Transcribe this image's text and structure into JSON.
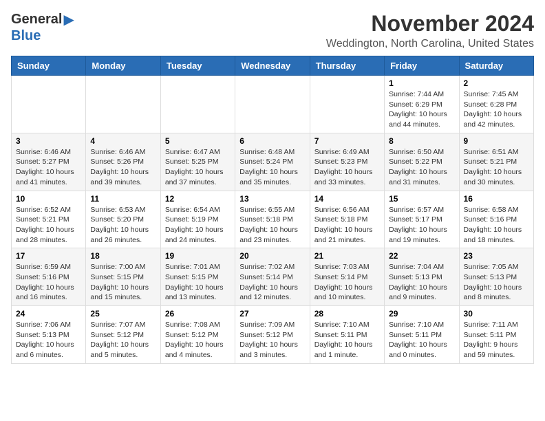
{
  "header": {
    "logo_general": "General",
    "logo_blue": "Blue",
    "month": "November 2024",
    "location": "Weddington, North Carolina, United States"
  },
  "days_of_week": [
    "Sunday",
    "Monday",
    "Tuesday",
    "Wednesday",
    "Thursday",
    "Friday",
    "Saturday"
  ],
  "weeks": [
    [
      {
        "day": "",
        "info": ""
      },
      {
        "day": "",
        "info": ""
      },
      {
        "day": "",
        "info": ""
      },
      {
        "day": "",
        "info": ""
      },
      {
        "day": "",
        "info": ""
      },
      {
        "day": "1",
        "info": "Sunrise: 7:44 AM\nSunset: 6:29 PM\nDaylight: 10 hours and 44 minutes."
      },
      {
        "day": "2",
        "info": "Sunrise: 7:45 AM\nSunset: 6:28 PM\nDaylight: 10 hours and 42 minutes."
      }
    ],
    [
      {
        "day": "3",
        "info": "Sunrise: 6:46 AM\nSunset: 5:27 PM\nDaylight: 10 hours and 41 minutes."
      },
      {
        "day": "4",
        "info": "Sunrise: 6:46 AM\nSunset: 5:26 PM\nDaylight: 10 hours and 39 minutes."
      },
      {
        "day": "5",
        "info": "Sunrise: 6:47 AM\nSunset: 5:25 PM\nDaylight: 10 hours and 37 minutes."
      },
      {
        "day": "6",
        "info": "Sunrise: 6:48 AM\nSunset: 5:24 PM\nDaylight: 10 hours and 35 minutes."
      },
      {
        "day": "7",
        "info": "Sunrise: 6:49 AM\nSunset: 5:23 PM\nDaylight: 10 hours and 33 minutes."
      },
      {
        "day": "8",
        "info": "Sunrise: 6:50 AM\nSunset: 5:22 PM\nDaylight: 10 hours and 31 minutes."
      },
      {
        "day": "9",
        "info": "Sunrise: 6:51 AM\nSunset: 5:21 PM\nDaylight: 10 hours and 30 minutes."
      }
    ],
    [
      {
        "day": "10",
        "info": "Sunrise: 6:52 AM\nSunset: 5:21 PM\nDaylight: 10 hours and 28 minutes."
      },
      {
        "day": "11",
        "info": "Sunrise: 6:53 AM\nSunset: 5:20 PM\nDaylight: 10 hours and 26 minutes."
      },
      {
        "day": "12",
        "info": "Sunrise: 6:54 AM\nSunset: 5:19 PM\nDaylight: 10 hours and 24 minutes."
      },
      {
        "day": "13",
        "info": "Sunrise: 6:55 AM\nSunset: 5:18 PM\nDaylight: 10 hours and 23 minutes."
      },
      {
        "day": "14",
        "info": "Sunrise: 6:56 AM\nSunset: 5:18 PM\nDaylight: 10 hours and 21 minutes."
      },
      {
        "day": "15",
        "info": "Sunrise: 6:57 AM\nSunset: 5:17 PM\nDaylight: 10 hours and 19 minutes."
      },
      {
        "day": "16",
        "info": "Sunrise: 6:58 AM\nSunset: 5:16 PM\nDaylight: 10 hours and 18 minutes."
      }
    ],
    [
      {
        "day": "17",
        "info": "Sunrise: 6:59 AM\nSunset: 5:16 PM\nDaylight: 10 hours and 16 minutes."
      },
      {
        "day": "18",
        "info": "Sunrise: 7:00 AM\nSunset: 5:15 PM\nDaylight: 10 hours and 15 minutes."
      },
      {
        "day": "19",
        "info": "Sunrise: 7:01 AM\nSunset: 5:15 PM\nDaylight: 10 hours and 13 minutes."
      },
      {
        "day": "20",
        "info": "Sunrise: 7:02 AM\nSunset: 5:14 PM\nDaylight: 10 hours and 12 minutes."
      },
      {
        "day": "21",
        "info": "Sunrise: 7:03 AM\nSunset: 5:14 PM\nDaylight: 10 hours and 10 minutes."
      },
      {
        "day": "22",
        "info": "Sunrise: 7:04 AM\nSunset: 5:13 PM\nDaylight: 10 hours and 9 minutes."
      },
      {
        "day": "23",
        "info": "Sunrise: 7:05 AM\nSunset: 5:13 PM\nDaylight: 10 hours and 8 minutes."
      }
    ],
    [
      {
        "day": "24",
        "info": "Sunrise: 7:06 AM\nSunset: 5:13 PM\nDaylight: 10 hours and 6 minutes."
      },
      {
        "day": "25",
        "info": "Sunrise: 7:07 AM\nSunset: 5:12 PM\nDaylight: 10 hours and 5 minutes."
      },
      {
        "day": "26",
        "info": "Sunrise: 7:08 AM\nSunset: 5:12 PM\nDaylight: 10 hours and 4 minutes."
      },
      {
        "day": "27",
        "info": "Sunrise: 7:09 AM\nSunset: 5:12 PM\nDaylight: 10 hours and 3 minutes."
      },
      {
        "day": "28",
        "info": "Sunrise: 7:10 AM\nSunset: 5:11 PM\nDaylight: 10 hours and 1 minute."
      },
      {
        "day": "29",
        "info": "Sunrise: 7:10 AM\nSunset: 5:11 PM\nDaylight: 10 hours and 0 minutes."
      },
      {
        "day": "30",
        "info": "Sunrise: 7:11 AM\nSunset: 5:11 PM\nDaylight: 9 hours and 59 minutes."
      }
    ]
  ]
}
